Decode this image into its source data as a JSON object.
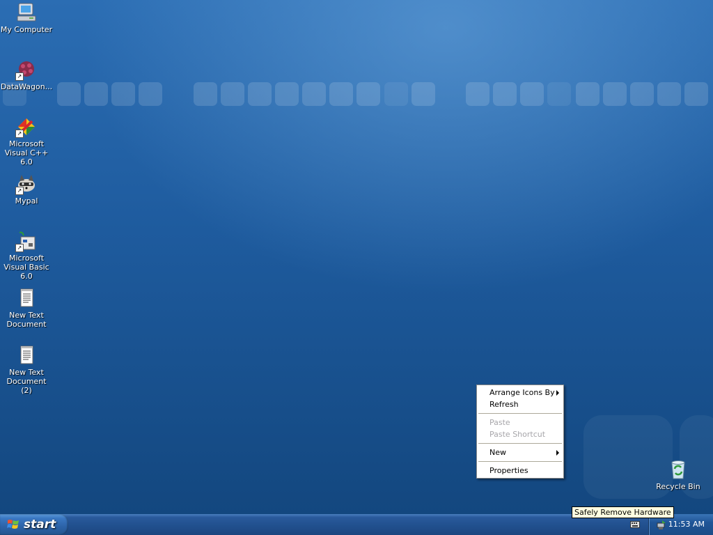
{
  "desktop": {
    "icons": [
      {
        "label": "My Computer",
        "icon": "my-computer-icon",
        "shortcut": false
      },
      {
        "label": "DataWagon...",
        "icon": "datawagon-icon",
        "shortcut": true
      },
      {
        "label": "Microsoft Visual C++ 6.0",
        "icon": "visual-cpp-icon",
        "shortcut": true
      },
      {
        "label": "Mypal",
        "icon": "mypal-raccoon-icon",
        "shortcut": true
      },
      {
        "label": "Microsoft Visual Basic 6.0",
        "icon": "visual-basic-icon",
        "shortcut": true
      },
      {
        "label": "New Text Document",
        "icon": "text-document-icon",
        "shortcut": false
      },
      {
        "label": "New Text Document (2)",
        "icon": "text-document-icon",
        "shortcut": false
      }
    ],
    "recycle_bin": {
      "label": "Recycle Bin",
      "icon": "recycle-bin-icon"
    }
  },
  "context_menu": {
    "items": [
      {
        "label": "Arrange Icons By",
        "submenu": true,
        "enabled": true
      },
      {
        "label": "Refresh",
        "submenu": false,
        "enabled": true
      },
      {
        "label": "Paste",
        "submenu": false,
        "enabled": false
      },
      {
        "label": "Paste Shortcut",
        "submenu": false,
        "enabled": false
      },
      {
        "label": "New",
        "submenu": true,
        "enabled": true
      },
      {
        "label": "Properties",
        "submenu": false,
        "enabled": true
      }
    ]
  },
  "taskbar": {
    "start_label": "start",
    "tooltip": "Safely Remove Hardware",
    "tray_icons": [
      "keyboard-icon",
      "safely-remove-hardware-icon"
    ],
    "clock": "11:53 AM"
  },
  "colors": {
    "desktop_blue": "#1e5b9e",
    "taskbar_blue": "#21508e",
    "menu_disabled_text": "#a7a6aa",
    "tooltip_bg": "#ffffe1"
  }
}
